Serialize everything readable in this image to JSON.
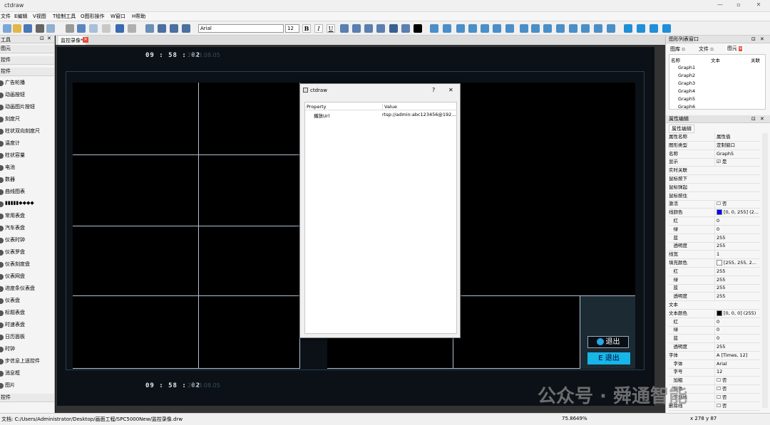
{
  "app": {
    "title": "ctdraw",
    "window_controls": [
      "—",
      "▫",
      "✕"
    ]
  },
  "menu": [
    "文件",
    "E编辑",
    "V视图",
    "T绘制工具",
    "O图形操作",
    "W窗口",
    "H帮助"
  ],
  "toolbar": {
    "font": "Arial",
    "size": "12",
    "bold": "B",
    "italic": "I",
    "underline": "U"
  },
  "left": {
    "title": "工具",
    "items": [
      {
        "label": "图元",
        "cat": true
      },
      {
        "label": "控件",
        "cat": true
      },
      {
        "label": "控件",
        "cat": true
      },
      {
        "label": "广告轮播"
      },
      {
        "label": "动画按钮"
      },
      {
        "label": "动画图片按钮"
      },
      {
        "label": "刻度尺"
      },
      {
        "label": "柱状双向刻度尺"
      },
      {
        "label": "温度计"
      },
      {
        "label": "柱状容量"
      },
      {
        "label": "电池"
      },
      {
        "label": "数器"
      },
      {
        "label": "曲线图表"
      },
      {
        "label": "▮▮▮▮▮◆◆◆◆"
      },
      {
        "label": "常用表盘"
      },
      {
        "label": "汽车表盘"
      },
      {
        "label": "仪表时钟"
      },
      {
        "label": "仪表罗盘"
      },
      {
        "label": "仪表刻度盘"
      },
      {
        "label": "仪表网盘"
      },
      {
        "label": "进度条仪表盘"
      },
      {
        "label": "仪表盘"
      },
      {
        "label": "标题表盘"
      },
      {
        "label": "时速表盘"
      },
      {
        "label": "日历面板"
      },
      {
        "label": "时钟"
      },
      {
        "label": "步信息上送控件"
      },
      {
        "label": "消息框"
      },
      {
        "label": "图片"
      },
      {
        "label": "控件",
        "cat": true
      }
    ]
  },
  "tab": {
    "label": "监控录像*",
    "close": "✕"
  },
  "hud": {
    "time": "09 : 58 : 02",
    "date": "2023.08.05",
    "exit1": "退出",
    "exit2": "E  退出"
  },
  "dialog": {
    "title": "ctdraw",
    "help": "?",
    "close": "✕",
    "col_property": "Property",
    "col_value": "Value",
    "rows": [
      {
        "property": "播放Url",
        "value": "rtsp://admin:abc123456@192..."
      }
    ]
  },
  "right": {
    "list_title": "图形列表窗口",
    "tabs": [
      "图库",
      "文件",
      "图元"
    ],
    "cols": [
      "名称",
      "文本",
      "关联"
    ],
    "graphs": [
      "Graph1",
      "Graph2",
      "Graph3",
      "Graph4",
      "Graph5",
      "Graph6"
    ],
    "prop_title": "属性编辑",
    "prop_tab": "属性编辑",
    "props": [
      {
        "k": "属性名称",
        "v": "属性值"
      },
      {
        "k": "图形类型",
        "v": "定制窗口"
      },
      {
        "k": "名称",
        "v": "Graph5"
      },
      {
        "k": "显示",
        "v": "☑ 是"
      },
      {
        "k": "实时关联",
        "v": ""
      },
      {
        "k": "鼠标按下",
        "v": ""
      },
      {
        "k": "鼠标弹起",
        "v": ""
      },
      {
        "k": "鼠标按住",
        "v": ""
      },
      {
        "k": "激活",
        "v": "☐ 否"
      },
      {
        "k": "线颜色",
        "v": "[0, 0, 255] (2...",
        "swatch": "#0000ff"
      },
      {
        "k": "　红",
        "v": "0"
      },
      {
        "k": "　绿",
        "v": "0"
      },
      {
        "k": "　蓝",
        "v": "255"
      },
      {
        "k": "　透明度",
        "v": "255"
      },
      {
        "k": "线宽",
        "v": "1"
      },
      {
        "k": "填充颜色",
        "v": "[255, 255, 2...",
        "swatch": "#ffffff"
      },
      {
        "k": "　红",
        "v": "255"
      },
      {
        "k": "　绿",
        "v": "255"
      },
      {
        "k": "　蓝",
        "v": "255"
      },
      {
        "k": "　透明度",
        "v": "255"
      },
      {
        "k": "文本",
        "v": ""
      },
      {
        "k": "文本颜色",
        "v": "[0, 0, 0] (255)",
        "swatch": "#000000"
      },
      {
        "k": "　红",
        "v": "0"
      },
      {
        "k": "　绿",
        "v": "0"
      },
      {
        "k": "　蓝",
        "v": "0"
      },
      {
        "k": "　透明度",
        "v": "255"
      },
      {
        "k": "字体",
        "v": "A  [Times, 12]"
      },
      {
        "k": "　字体",
        "v": "Arial"
      },
      {
        "k": "　字号",
        "v": "12"
      },
      {
        "k": "　加粗",
        "v": "☐ 否"
      },
      {
        "k": "　斜体",
        "v": "☐ 否"
      },
      {
        "k": "　下划线",
        "v": "☐ 否"
      },
      {
        "k": "删除线",
        "v": "☐ 否"
      }
    ]
  },
  "status": {
    "path": "文档: C:/Users/Administrator/Desktop/画面工程/SPC5000New/监控录像.drw",
    "zoom": "75.8649%",
    "size": "x 278 y 87"
  },
  "watermark": "公众号 · 舜通智能",
  "colors": {
    "accent": "#00a0d8",
    "hud_bg": "#0b1117",
    "selection": "#0000ff"
  }
}
